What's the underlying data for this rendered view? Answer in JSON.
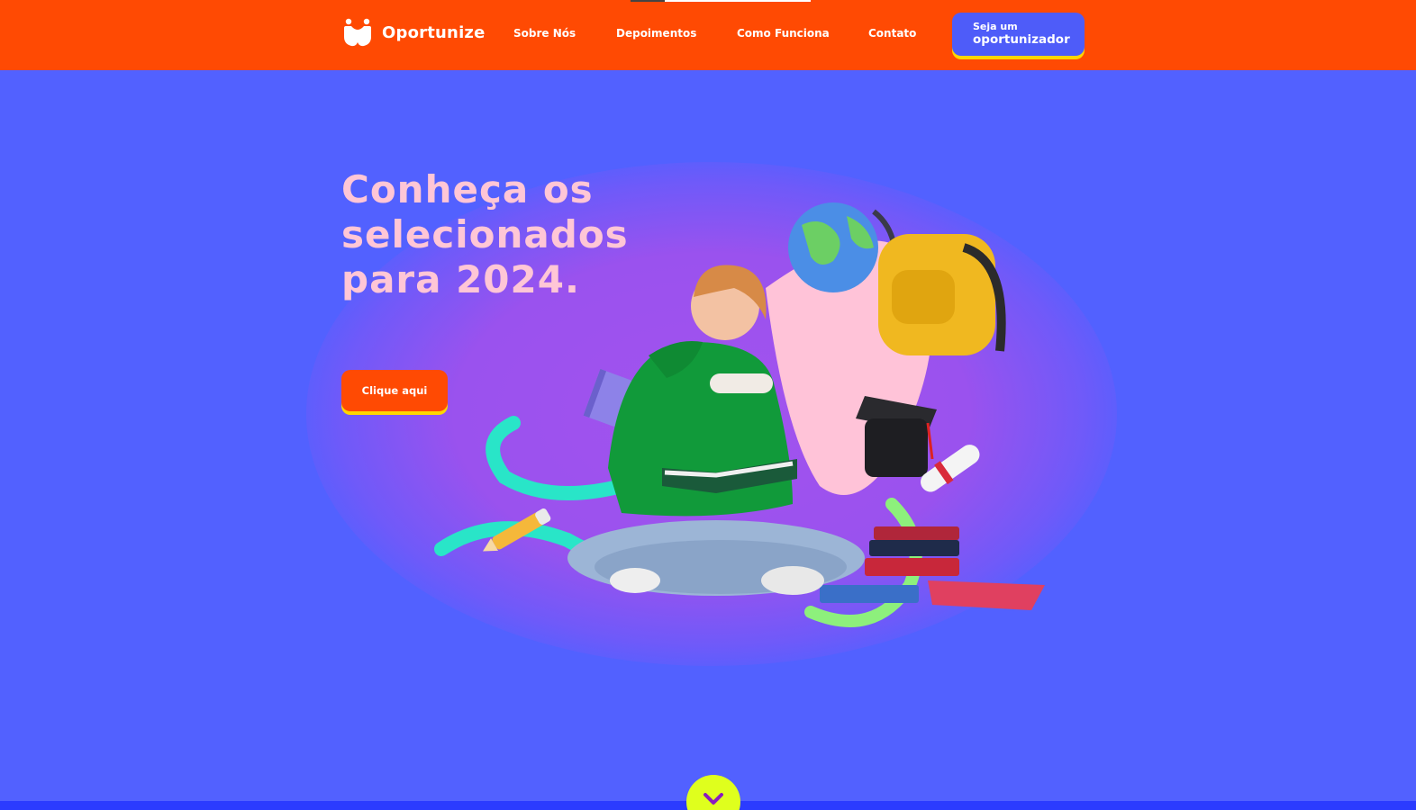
{
  "header": {
    "brand": "Oportunize",
    "nav": [
      {
        "label": "Sobre Nós"
      },
      {
        "label": "Depoimentos"
      },
      {
        "label": "Como Funciona"
      },
      {
        "label": "Contato"
      }
    ],
    "cta": {
      "line1": "Seja um",
      "line2": "oportunizador"
    }
  },
  "hero": {
    "headline": "Conheça os selecionados para 2024.",
    "button_label": "Clique aqui"
  },
  "colors": {
    "header_bg": "#ff4a03",
    "page_bg": "#5261ff",
    "headline": "#ffc6d6",
    "cta_shadow": "#ffd600",
    "scroll_button": "#dfff1d"
  },
  "icons": {
    "logo": "people-hug-icon",
    "scroll": "chevron-down-icon"
  }
}
